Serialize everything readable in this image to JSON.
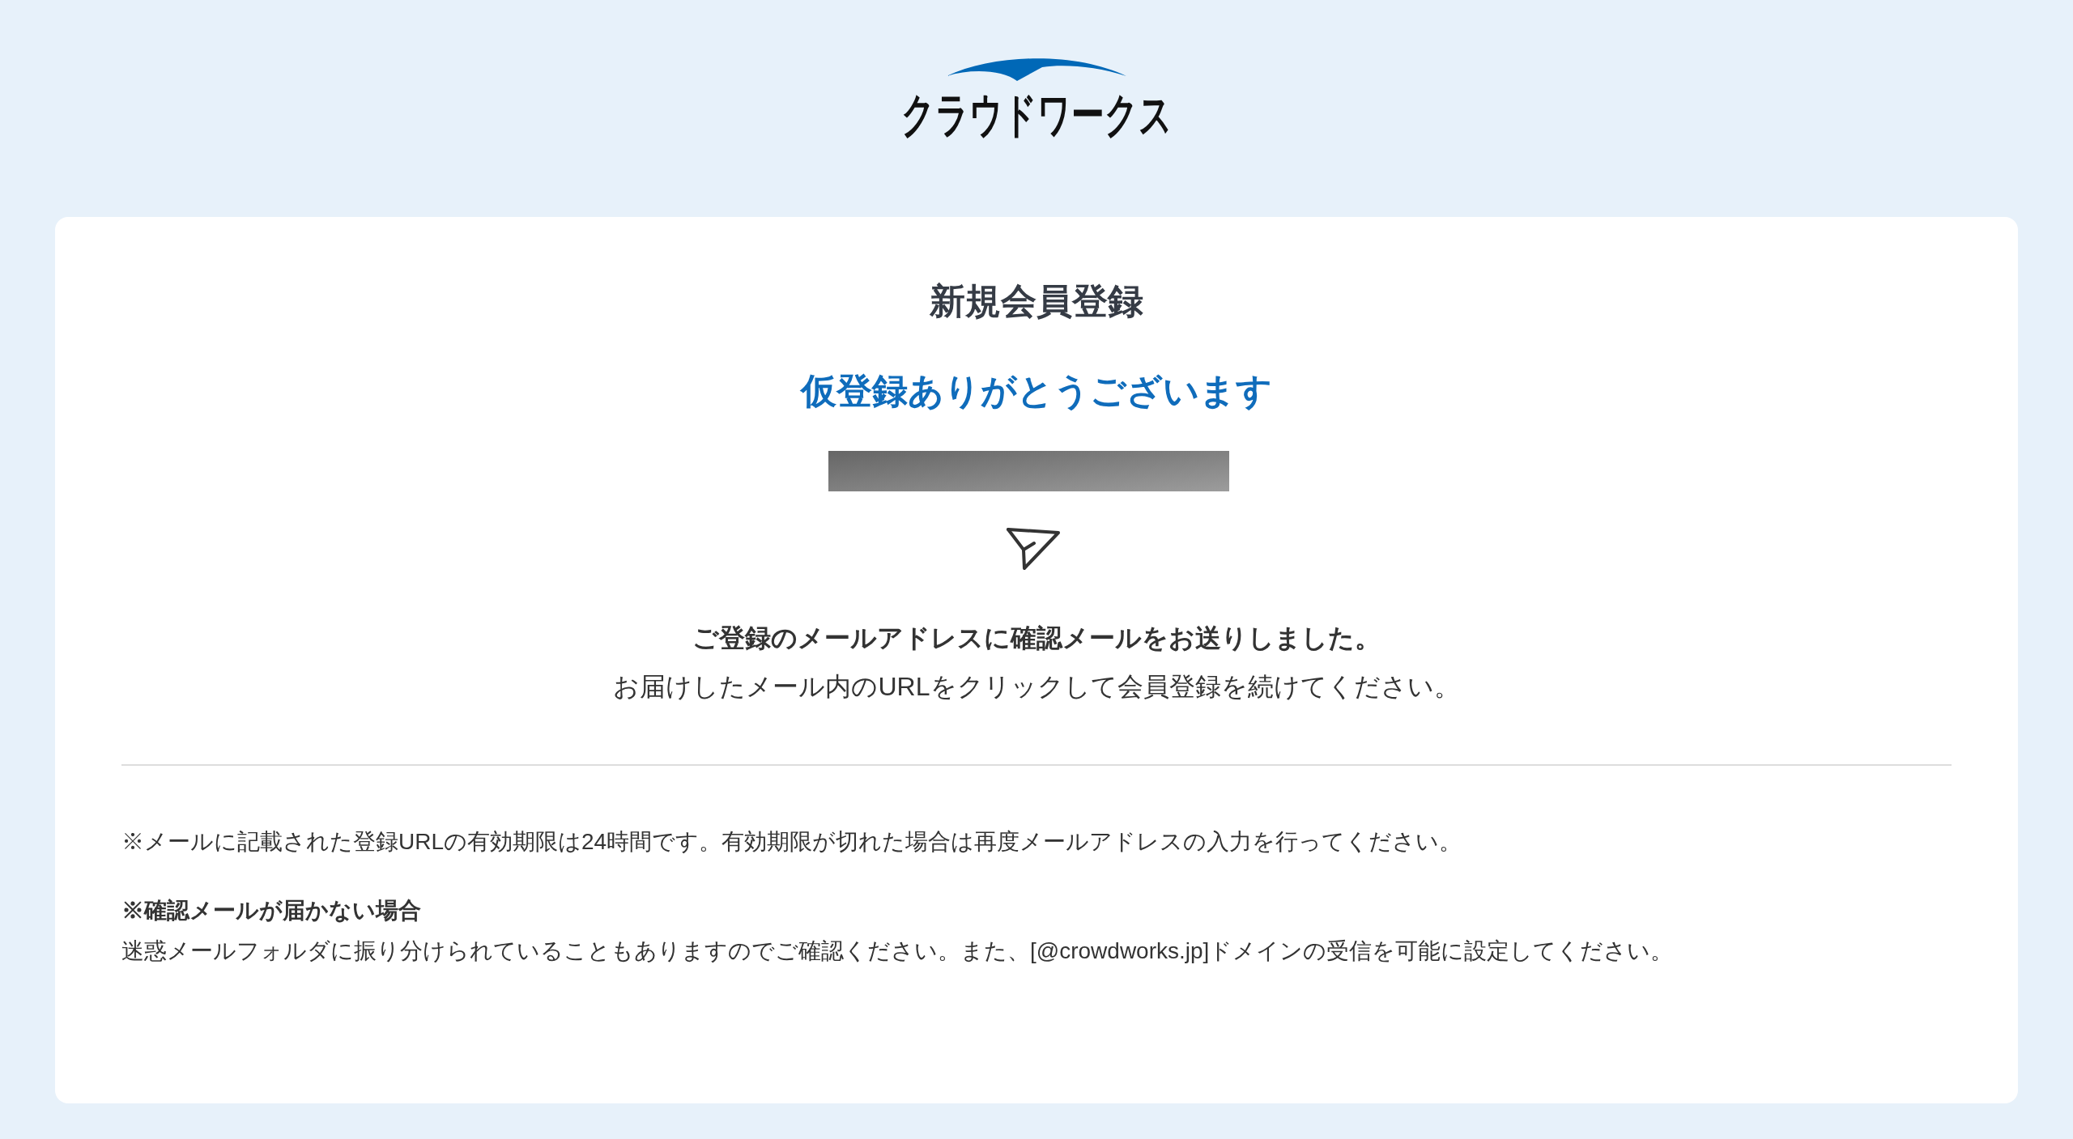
{
  "logo": {
    "text": "クラウドワークス"
  },
  "card": {
    "title": "新規会員登録",
    "heading": "仮登録ありがとうございます",
    "message": {
      "lead": "ご登録のメールアドレスに確認メールをお送りしました。",
      "body": "お届けしたメール内のURLをクリックして会員登録を続けてください。"
    },
    "notes": [
      {
        "kind": "text",
        "text": "※メールに記載された登録URLの有効期限は24時間です。有効期限が切れた場合は再度メールアドレスの入力を行ってください。"
      },
      {
        "kind": "heading",
        "text": "※確認メールが届かない場合"
      },
      {
        "kind": "text",
        "text": "迷惑メールフォルダに振り分けられていることもありますのでご確認ください。また、[@crowdworks.jp]ドメインの受信を可能に設定してください。"
      }
    ]
  }
}
